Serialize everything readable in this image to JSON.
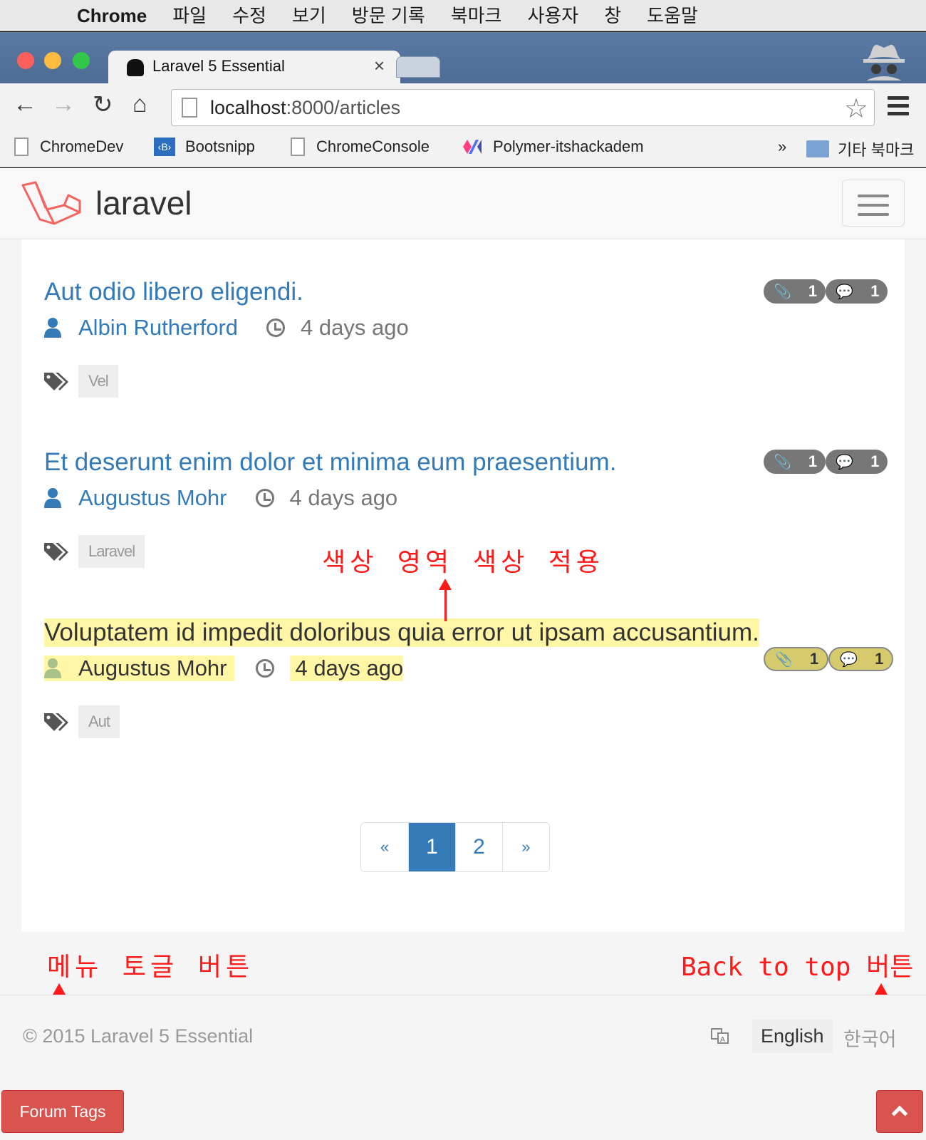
{
  "menubar": {
    "app": "Chrome",
    "items": [
      "파일",
      "수정",
      "보기",
      "방문 기록",
      "북마크",
      "사용자",
      "창",
      "도움말"
    ]
  },
  "tab": {
    "title": "Laravel 5 Essential",
    "close": "×"
  },
  "omnibox": {
    "host": "localhost",
    "path": ":8000/articles"
  },
  "bookmarks": [
    "ChromeDev",
    "Bootsnipp",
    "ChromeConsole",
    "Polymer-itshackadem",
    "»",
    "기타 북마크"
  ],
  "navbar": {
    "brand": "laravel"
  },
  "articles": [
    {
      "title": "Aut odio libero eligendi.",
      "author": "Albin Rutherford",
      "ago": "4 days ago",
      "tag": "Vel",
      "attachments": "1",
      "comments": "1"
    },
    {
      "title": "Et deserunt enim dolor et minima eum praesentium.",
      "author": "Augustus Mohr",
      "ago": "4 days ago",
      "tag": "Laravel",
      "attachments": "1",
      "comments": "1"
    },
    {
      "title": "Voluptatem id impedit doloribus quia error ut ipsam accusantium.",
      "author": "Augustus Mohr",
      "ago": "4 days ago",
      "tag": "Aut",
      "attachments": "1",
      "comments": "1"
    }
  ],
  "pagination": {
    "prev": "«",
    "pages": [
      "1",
      "2"
    ],
    "next": "»",
    "active": "1"
  },
  "annotations": {
    "highlight": "색상 영역 색상 적용",
    "menu_toggle": "메뉴 토글 버튼",
    "back_to_top": "Back to top 버튼"
  },
  "footer": {
    "copyright": "© 2015   Laravel 5 Essential",
    "lang_en": "English",
    "lang_ko": "한국어"
  },
  "forum_tags": "Forum Tags",
  "colors": {
    "link": "#337ab7",
    "danger": "#d9534f",
    "highlight": "#fff6a6",
    "annotation": "#ff1a1a"
  }
}
